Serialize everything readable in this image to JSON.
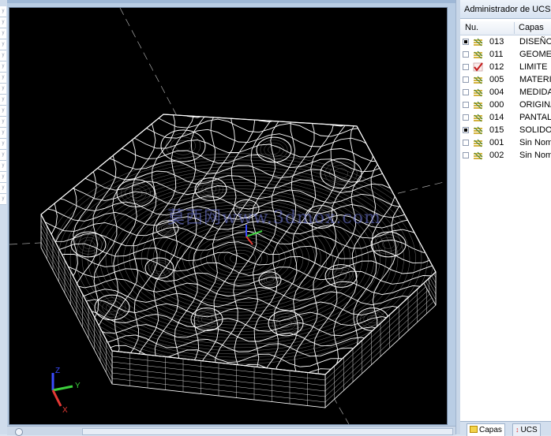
{
  "panel": {
    "title": "Administrador de UCS",
    "columns": {
      "num": "Nu.",
      "layers": "Capas"
    }
  },
  "layers": [
    {
      "checked": true,
      "icon": "layer-stack-icon",
      "num": "013",
      "name": "DISEÑO"
    },
    {
      "checked": false,
      "icon": "layer-stack-icon",
      "num": "011",
      "name": "GEOMETRÍA"
    },
    {
      "checked": false,
      "icon": "active-check-icon",
      "num": "012",
      "name": "LIMITE"
    },
    {
      "checked": false,
      "icon": "layer-stack-icon",
      "num": "005",
      "name": "MATERIAL"
    },
    {
      "checked": false,
      "icon": "layer-stack-icon",
      "num": "004",
      "name": "MEDIDAS"
    },
    {
      "checked": false,
      "icon": "layer-stack-icon",
      "num": "000",
      "name": "ORIGINAL"
    },
    {
      "checked": false,
      "icon": "layer-stack-icon",
      "num": "014",
      "name": "PANTALLA"
    },
    {
      "checked": true,
      "icon": "layer-stack-icon",
      "num": "015",
      "name": "SOLIDO"
    },
    {
      "checked": false,
      "icon": "layer-stack-icon",
      "num": "001",
      "name": "Sin Nombre"
    },
    {
      "checked": false,
      "icon": "layer-stack-icon",
      "num": "002",
      "name": "Sin Nombre"
    }
  ],
  "tabs": {
    "layers": "Capas",
    "ucs": "UCS"
  },
  "viewport": {
    "watermark": "莫西网www.3dmox.com",
    "axis_labels": {
      "x": "X",
      "y": "Y",
      "z": "Z"
    },
    "colors": {
      "background": "#000000",
      "wire": "#ffffff",
      "x_axis": "#e53935",
      "y_axis": "#3ccf3c",
      "z_axis": "#3b4bff"
    }
  },
  "left_strip_items": [
    "y",
    "y",
    "y",
    "y",
    "y",
    "y",
    "y",
    "y",
    "y",
    "y",
    "y",
    "y",
    "y",
    "y",
    "y",
    "y",
    "y",
    "y"
  ]
}
